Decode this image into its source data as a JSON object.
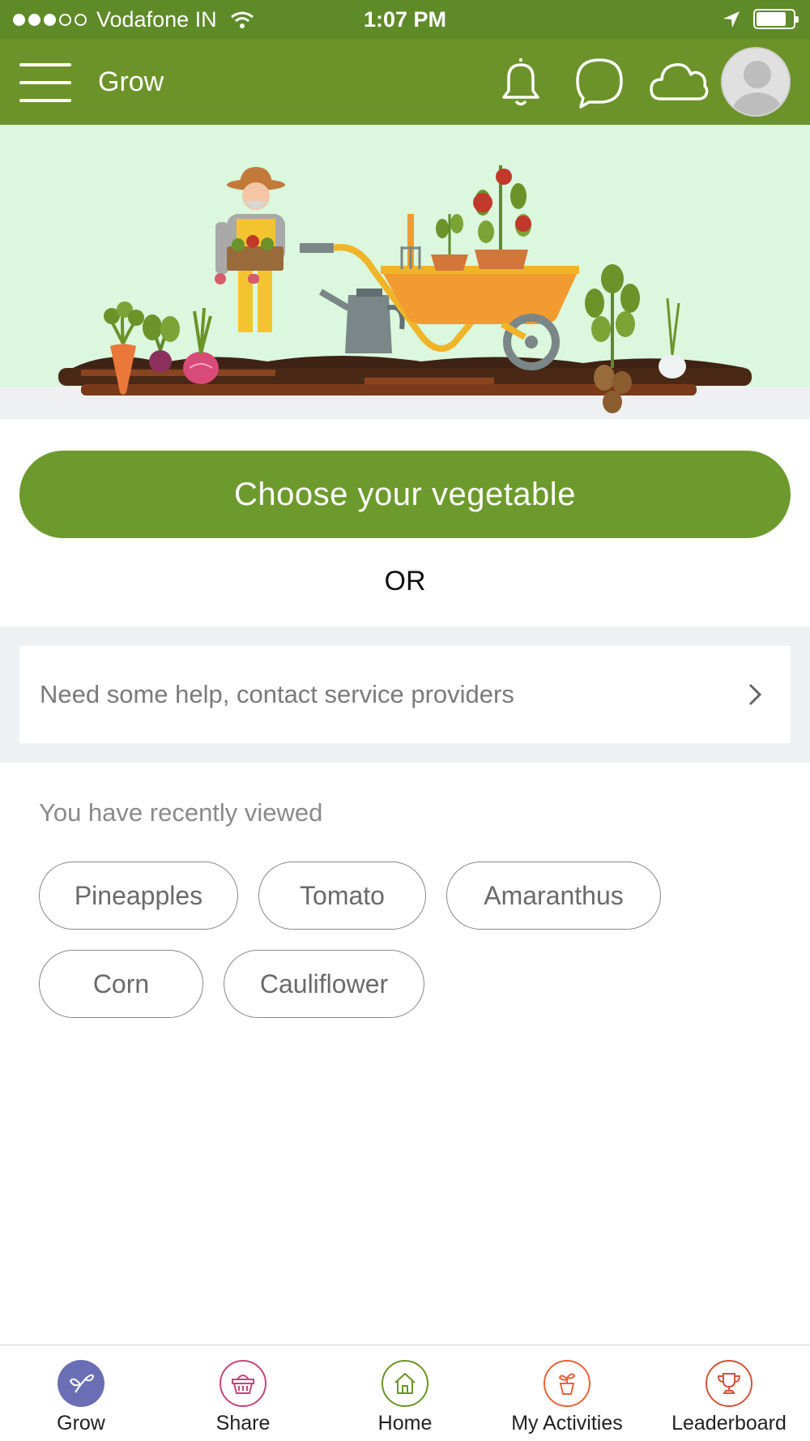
{
  "status_bar": {
    "carrier": "Vodafone IN",
    "time": "1:07 PM",
    "signal_bars_filled": 3,
    "signal_bars_total": 5,
    "battery_level": 0.82
  },
  "app_bar": {
    "title": "Grow",
    "icons": [
      "menu-icon",
      "bell-icon",
      "chat-icon",
      "cloud-icon",
      "avatar"
    ]
  },
  "main": {
    "cta_label": "Choose your vegetable",
    "or_label": "OR",
    "help_label": "Need some help, contact service providers",
    "recent_title": "You have recently viewed",
    "recent_items": [
      "Pineapples",
      "Tomato",
      "Amaranthus",
      "Corn",
      "Cauliflower"
    ]
  },
  "tabs": [
    {
      "label": "Grow",
      "icon": "sprout-icon",
      "color": "#6a6fb5",
      "active": true
    },
    {
      "label": "Share",
      "icon": "basket-icon",
      "color": "#c4457a",
      "active": false
    },
    {
      "label": "Home",
      "icon": "home-icon",
      "color": "#6b9329",
      "active": false
    },
    {
      "label": "My Activities",
      "icon": "potted-plant-icon",
      "color": "#e8633a",
      "active": false
    },
    {
      "label": "Leaderboard",
      "icon": "trophy-icon",
      "color": "#d0553a",
      "active": false
    }
  ],
  "colors": {
    "status_bar": "#5e8a28",
    "app_bar": "#6b9329",
    "cta": "#6d9a2d",
    "banner_bg": "#dbf7dd",
    "band_bg": "#eff0f1"
  }
}
